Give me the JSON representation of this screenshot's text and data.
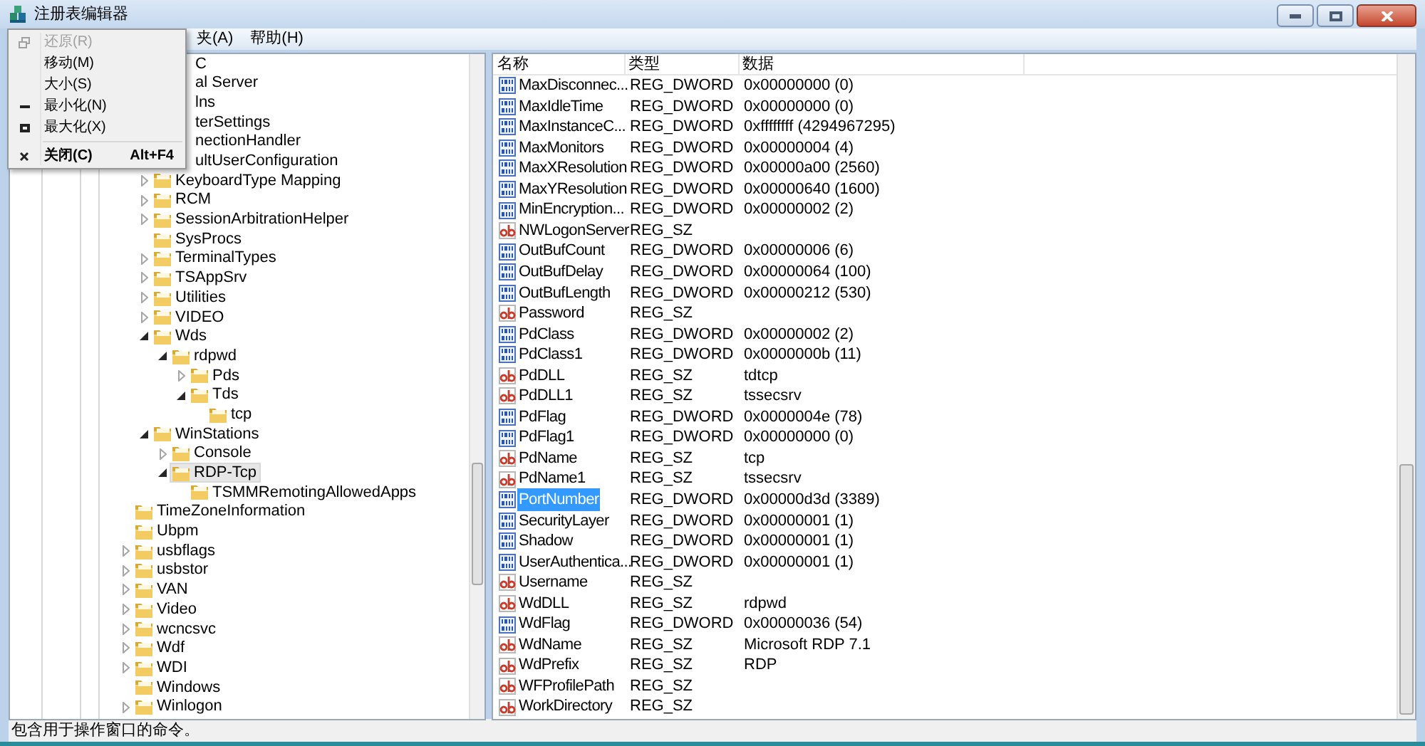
{
  "window": {
    "title": "注册表编辑器"
  },
  "menu_bar": [
    "夹(A)",
    "帮助(H)"
  ],
  "system_menu": [
    {
      "label": "还原(R)",
      "kind": "restore",
      "disabled": true
    },
    {
      "label": "移动(M)",
      "kind": "plain",
      "disabled": false
    },
    {
      "label": "大小(S)",
      "kind": "plain",
      "disabled": false
    },
    {
      "label": "最小化(N)",
      "kind": "minimize",
      "disabled": false
    },
    {
      "label": "最大化(X)",
      "kind": "maximize",
      "disabled": false
    },
    {
      "label": "关闭(C)",
      "kind": "close",
      "disabled": false,
      "shortcut": "Alt+F4"
    }
  ],
  "tree": [
    {
      "label": "C",
      "kind": "clipped",
      "selected": false
    },
    {
      "label": "al Server",
      "kind": "clipped",
      "selected": false,
      "children": [
        {
          "label": "lns",
          "kind": "clipped",
          "selected": false
        },
        {
          "label": "terSettings",
          "kind": "clipped",
          "selected": false
        },
        {
          "label": "nectionHandler",
          "kind": "clipped",
          "selected": false
        },
        {
          "label": "ultUserConfiguration",
          "kind": "clipped",
          "selected": false
        },
        {
          "label": "KeyboardType Mapping",
          "selected": false,
          "expanded": false
        },
        {
          "label": "RCM",
          "selected": false,
          "expanded": false
        },
        {
          "label": "SessionArbitrationHelper",
          "selected": false,
          "expanded": false
        },
        {
          "label": "SysProcs",
          "selected": false
        },
        {
          "label": "TerminalTypes",
          "selected": false,
          "expanded": false
        },
        {
          "label": "TSAppSrv",
          "selected": false,
          "expanded": false
        },
        {
          "label": "Utilities",
          "selected": false,
          "expanded": false
        },
        {
          "label": "VIDEO",
          "selected": false,
          "expanded": false
        },
        {
          "label": "Wds",
          "selected": false,
          "expanded": true,
          "children": [
            {
              "label": "rdpwd",
              "selected": false,
              "expanded": true,
              "children": [
                {
                  "label": "Pds",
                  "selected": false,
                  "expanded": false
                },
                {
                  "label": "Tds",
                  "selected": false,
                  "expanded": true,
                  "children": [
                    {
                      "label": "tcp",
                      "selected": false
                    }
                  ]
                }
              ]
            }
          ]
        },
        {
          "label": "WinStations",
          "selected": false,
          "expanded": true,
          "children": [
            {
              "label": "Console",
              "selected": false,
              "expanded": false
            },
            {
              "label": "RDP-Tcp",
              "selected": true,
              "expanded": true,
              "children": [
                {
                  "label": "TSMMRemotingAllowedApps",
                  "selected": false
                }
              ]
            }
          ]
        }
      ]
    },
    {
      "label": "TimeZoneInformation",
      "selected": false
    },
    {
      "label": "Ubpm",
      "selected": false
    },
    {
      "label": "usbflags",
      "selected": false,
      "expanded": false
    },
    {
      "label": "usbstor",
      "selected": false,
      "expanded": false
    },
    {
      "label": "VAN",
      "selected": false,
      "expanded": false
    },
    {
      "label": "Video",
      "selected": false,
      "expanded": false
    },
    {
      "label": "wcncsvc",
      "selected": false,
      "expanded": false
    },
    {
      "label": "Wdf",
      "selected": false,
      "expanded": false
    },
    {
      "label": "WDI",
      "selected": false,
      "expanded": false
    },
    {
      "label": "Windows",
      "selected": false
    },
    {
      "label": "Winlogon",
      "selected": false,
      "expanded": false
    }
  ],
  "values_table": {
    "columns": [
      "名称",
      "类型",
      "数据"
    ],
    "rows": [
      {
        "name": "MaxDisconnec...",
        "type": "REG_DWORD",
        "data": "0x00000000 (0)",
        "kind": "dword",
        "selected": false
      },
      {
        "name": "MaxIdleTime",
        "type": "REG_DWORD",
        "data": "0x00000000 (0)",
        "kind": "dword",
        "selected": false
      },
      {
        "name": "MaxInstanceC...",
        "type": "REG_DWORD",
        "data": "0xffffffff (4294967295)",
        "kind": "dword",
        "selected": false
      },
      {
        "name": "MaxMonitors",
        "type": "REG_DWORD",
        "data": "0x00000004 (4)",
        "kind": "dword",
        "selected": false
      },
      {
        "name": "MaxXResolution",
        "type": "REG_DWORD",
        "data": "0x00000a00 (2560)",
        "kind": "dword",
        "selected": false
      },
      {
        "name": "MaxYResolution",
        "type": "REG_DWORD",
        "data": "0x00000640 (1600)",
        "kind": "dword",
        "selected": false
      },
      {
        "name": "MinEncryption...",
        "type": "REG_DWORD",
        "data": "0x00000002 (2)",
        "kind": "dword",
        "selected": false
      },
      {
        "name": "NWLogonServer",
        "type": "REG_SZ",
        "kind": "sz",
        "selected": false
      },
      {
        "name": "OutBufCount",
        "type": "REG_DWORD",
        "data": "0x00000006 (6)",
        "kind": "dword",
        "selected": false
      },
      {
        "name": "OutBufDelay",
        "type": "REG_DWORD",
        "data": "0x00000064 (100)",
        "kind": "dword",
        "selected": false
      },
      {
        "name": "OutBufLength",
        "type": "REG_DWORD",
        "data": "0x00000212 (530)",
        "kind": "dword",
        "selected": false
      },
      {
        "name": "Password",
        "type": "REG_SZ",
        "kind": "sz",
        "selected": false
      },
      {
        "name": "PdClass",
        "type": "REG_DWORD",
        "data": "0x00000002 (2)",
        "kind": "dword",
        "selected": false
      },
      {
        "name": "PdClass1",
        "type": "REG_DWORD",
        "data": "0x0000000b (11)",
        "kind": "dword",
        "selected": false
      },
      {
        "name": "PdDLL",
        "type": "REG_SZ",
        "data": "tdtcp",
        "kind": "sz",
        "selected": false
      },
      {
        "name": "PdDLL1",
        "type": "REG_SZ",
        "data": "tssecsrv",
        "kind": "sz",
        "selected": false
      },
      {
        "name": "PdFlag",
        "type": "REG_DWORD",
        "data": "0x0000004e (78)",
        "kind": "dword",
        "selected": false
      },
      {
        "name": "PdFlag1",
        "type": "REG_DWORD",
        "data": "0x00000000 (0)",
        "kind": "dword",
        "selected": false
      },
      {
        "name": "PdName",
        "type": "REG_SZ",
        "data": "tcp",
        "kind": "sz",
        "selected": false
      },
      {
        "name": "PdName1",
        "type": "REG_SZ",
        "data": "tssecsrv",
        "kind": "sz",
        "selected": false
      },
      {
        "name": "PortNumber",
        "type": "REG_DWORD",
        "data": "0x00000d3d (3389)",
        "kind": "dword",
        "selected": true
      },
      {
        "name": "SecurityLayer",
        "type": "REG_DWORD",
        "data": "0x00000001 (1)",
        "kind": "dword",
        "selected": false
      },
      {
        "name": "Shadow",
        "type": "REG_DWORD",
        "data": "0x00000001 (1)",
        "kind": "dword",
        "selected": false
      },
      {
        "name": "UserAuthentica...",
        "type": "REG_DWORD",
        "data": "0x00000001 (1)",
        "kind": "dword",
        "selected": false
      },
      {
        "name": "Username",
        "type": "REG_SZ",
        "kind": "sz",
        "selected": false
      },
      {
        "name": "WdDLL",
        "type": "REG_SZ",
        "data": "rdpwd",
        "kind": "sz",
        "selected": false
      },
      {
        "name": "WdFlag",
        "type": "REG_DWORD",
        "data": "0x00000036 (54)",
        "kind": "dword",
        "selected": false
      },
      {
        "name": "WdName",
        "type": "REG_SZ",
        "data": "Microsoft RDP 7.1",
        "kind": "sz",
        "selected": false
      },
      {
        "name": "WdPrefix",
        "type": "REG_SZ",
        "data": "RDP",
        "kind": "sz",
        "selected": false
      },
      {
        "name": "WFProfilePath",
        "type": "REG_SZ",
        "kind": "sz",
        "selected": false
      },
      {
        "name": "WorkDirectory",
        "type": "REG_SZ",
        "kind": "sz",
        "selected": false
      }
    ]
  },
  "status_bar": "包含用于操作窗口的命令。"
}
